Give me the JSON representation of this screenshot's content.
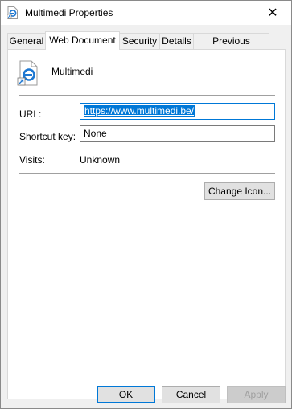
{
  "window": {
    "title": "Multimedi Properties",
    "close_glyph": "✕"
  },
  "tabs": [
    {
      "label": "General"
    },
    {
      "label": "Web Document"
    },
    {
      "label": "Security"
    },
    {
      "label": "Details"
    },
    {
      "label": "Previous Versions"
    }
  ],
  "active_tab": "Web Document",
  "file": {
    "name": "Multimedi",
    "icon": "internet-shortcut-icon"
  },
  "url": {
    "label": "URL:",
    "value": "https://www.multimedi.be/"
  },
  "shortcut_key": {
    "label": "Shortcut key:",
    "value": "None"
  },
  "visits": {
    "label": "Visits:",
    "value": "Unknown"
  },
  "buttons": {
    "change_icon": "Change Icon...",
    "ok": "OK",
    "cancel": "Cancel",
    "apply": "Apply"
  },
  "colors": {
    "accent": "#0078d7"
  }
}
